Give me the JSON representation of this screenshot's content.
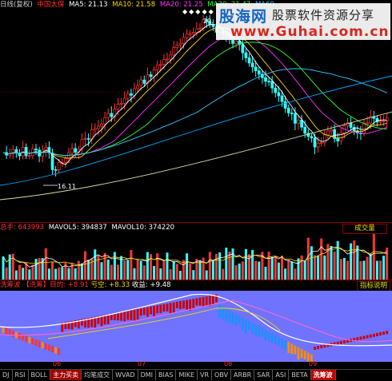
{
  "main": {
    "title": "日线(复权)",
    "stock_name": "中国太保",
    "ma": [
      {
        "label": "MA5: 21.13",
        "color": "#ffffff"
      },
      {
        "label": "MA10: 21.58",
        "color": "#ffd700"
      },
      {
        "label": "MA20: 21.25",
        "color": "#ff33ff"
      },
      {
        "label": "MA30: 21.47",
        "color": "#33ff33"
      },
      {
        "label": "MA60",
        "color": "#33ccff"
      }
    ],
    "diamonds": "◆◆◆◆◆",
    "high_label": "29.",
    "low_label": "16.11"
  },
  "watermark": {
    "logo": "股海网",
    "slogan": "股票软件资源分享",
    "url": "www.Guhai.com.cn"
  },
  "volume": {
    "total_label": "总手: 643993",
    "mavol5": "MAVOL5: 394837",
    "mavol10": "MAVOL10: 374220",
    "panel_label": "成交量"
  },
  "indicator": {
    "name": "洗筹波",
    "bracket": "【洗筹】目的:",
    "v1": "+8.91",
    "v2_label": "亏空:",
    "v2": "+8.33",
    "v3_label": "收益:",
    "v3": "+9.48",
    "explain": "指标说明"
  },
  "dates": [
    "06",
    "07",
    "08",
    "09"
  ],
  "tabs": [
    {
      "label": "DJ"
    },
    {
      "label": "RSI"
    },
    {
      "label": "BOLL"
    },
    {
      "label": "主力买卖",
      "style": "red"
    },
    {
      "label": "均笔成交"
    },
    {
      "label": "WVAD"
    },
    {
      "label": "DMI"
    },
    {
      "label": "BIAS"
    },
    {
      "label": "MIKE"
    },
    {
      "label": "VR"
    },
    {
      "label": "OBV"
    },
    {
      "label": "ARBR"
    },
    {
      "label": "SAR"
    },
    {
      "label": "ASI"
    },
    {
      "label": "BETA"
    },
    {
      "label": "洗筹波",
      "style": "active"
    }
  ]
}
